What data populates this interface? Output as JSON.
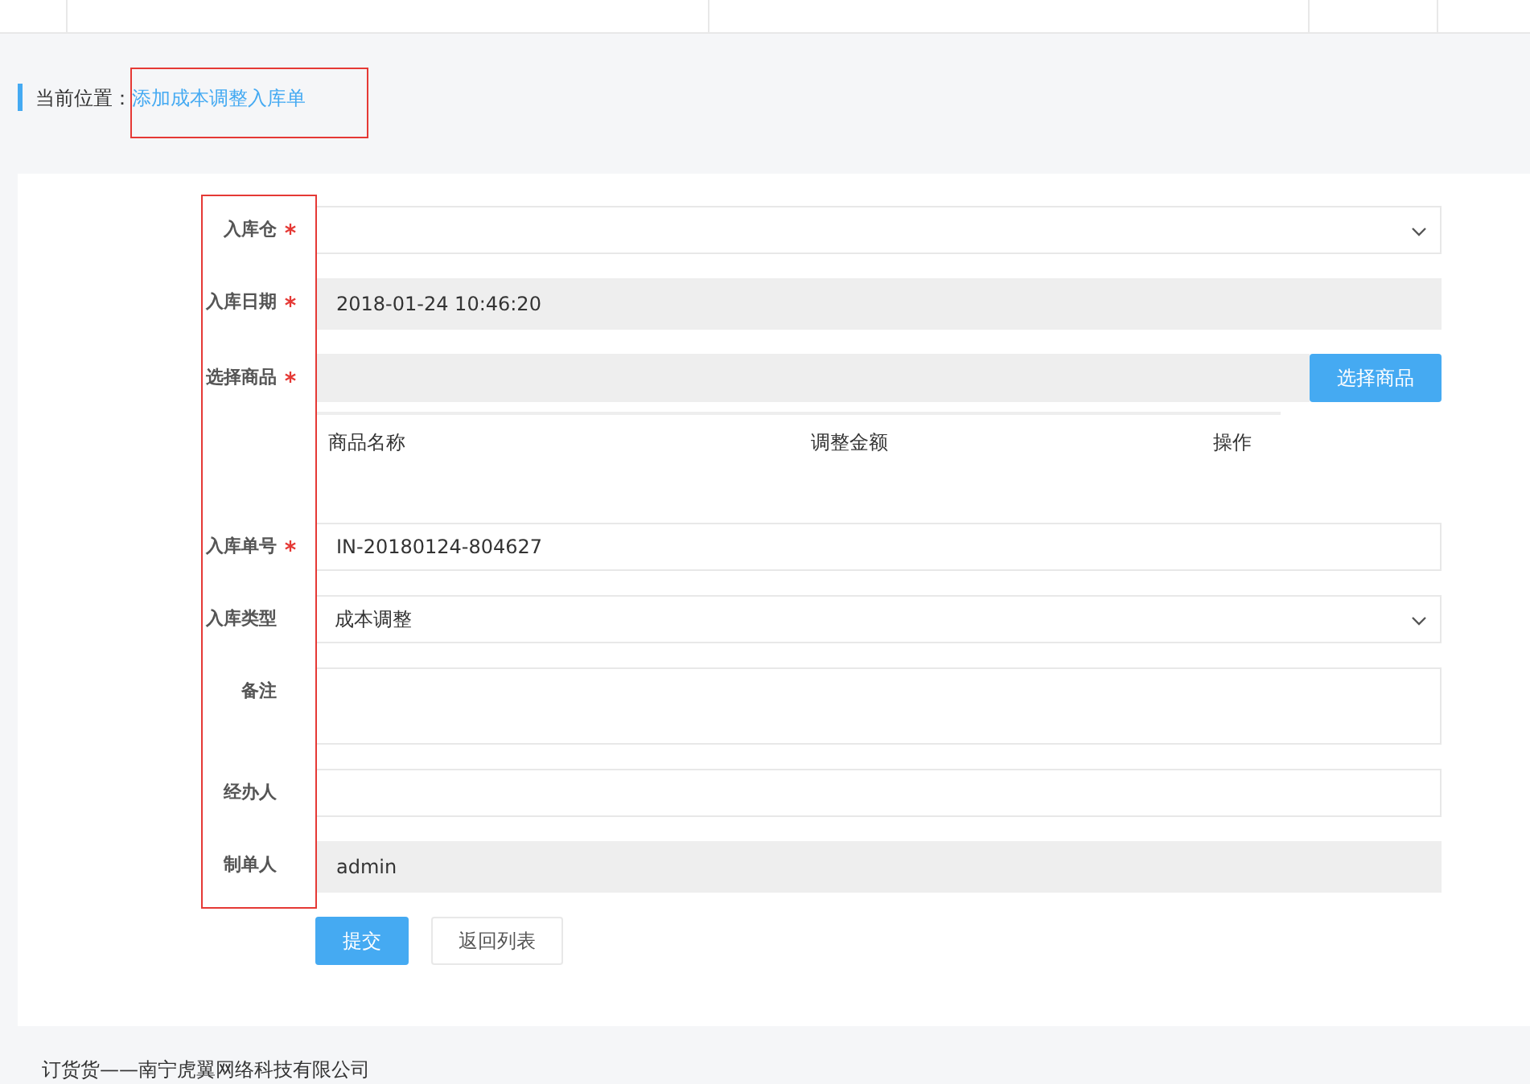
{
  "breadcrumb": {
    "label": "当前位置：",
    "current": "添加成本调整入库单"
  },
  "fields": [
    {
      "kind": "select",
      "label": "入库仓",
      "required": true
    },
    {
      "kind": "readonly",
      "label": "入库日期",
      "required": true,
      "value": "2018-01-24 10:46:20"
    },
    {
      "kind": "picker",
      "label": "选择商品",
      "required": true,
      "button": "选择商品"
    },
    {
      "kind": "table",
      "columns": [
        "商品名称",
        "调整金额",
        "操作"
      ]
    },
    {
      "kind": "text",
      "label": "入库单号",
      "required": true,
      "value": "IN-20180124-804627"
    },
    {
      "kind": "select",
      "label": "入库类型",
      "required": false,
      "value": "成本调整"
    },
    {
      "kind": "textarea",
      "label": "备注",
      "required": false
    },
    {
      "kind": "text",
      "label": "经办人",
      "required": false
    },
    {
      "kind": "readonly",
      "label": "制单人",
      "required": false,
      "value": "admin"
    }
  ],
  "buttons": [
    {
      "label": "提交",
      "primary": true
    },
    {
      "label": "返回列表",
      "primary": false
    }
  ],
  "footer": "订货货——南宁虎翼网络科技有限公司"
}
